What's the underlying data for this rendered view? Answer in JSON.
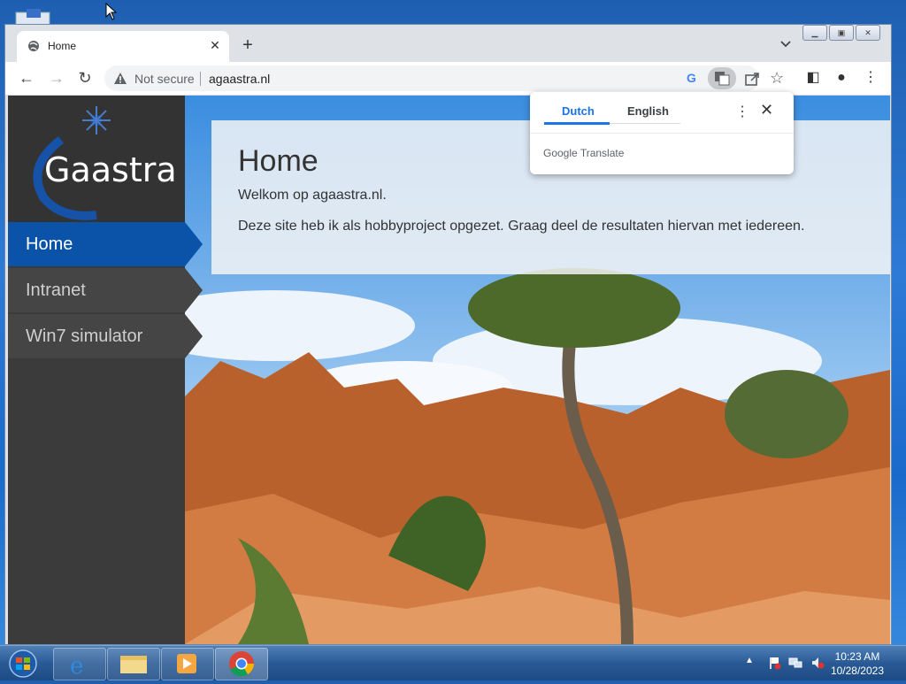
{
  "browser": {
    "tab_title": "Home",
    "omnibox": {
      "security_label": "Not secure",
      "url": "agaastra.nl"
    }
  },
  "site": {
    "logo_text": "Gaastra",
    "nav": [
      {
        "label": "Home",
        "active": true
      },
      {
        "label": "Intranet",
        "active": false
      },
      {
        "label": "Win7 simulator",
        "active": false
      }
    ],
    "page_title": "Home",
    "intro": "Welkom op agaastra.nl.",
    "description": "Deze site heb ik als hobbyproject opgezet. Graag deel de resultaten hiervan met iedereen."
  },
  "translate_popup": {
    "source_language": "Dutch",
    "target_language": "English",
    "brand": "Google Translate"
  },
  "taskbar": {
    "time": "10:23 AM",
    "date": "10/28/2023"
  },
  "colors": {
    "active_nav": "#0a53a8",
    "sidebar": "#3b3b3b",
    "translate_accent": "#1a73e8"
  }
}
